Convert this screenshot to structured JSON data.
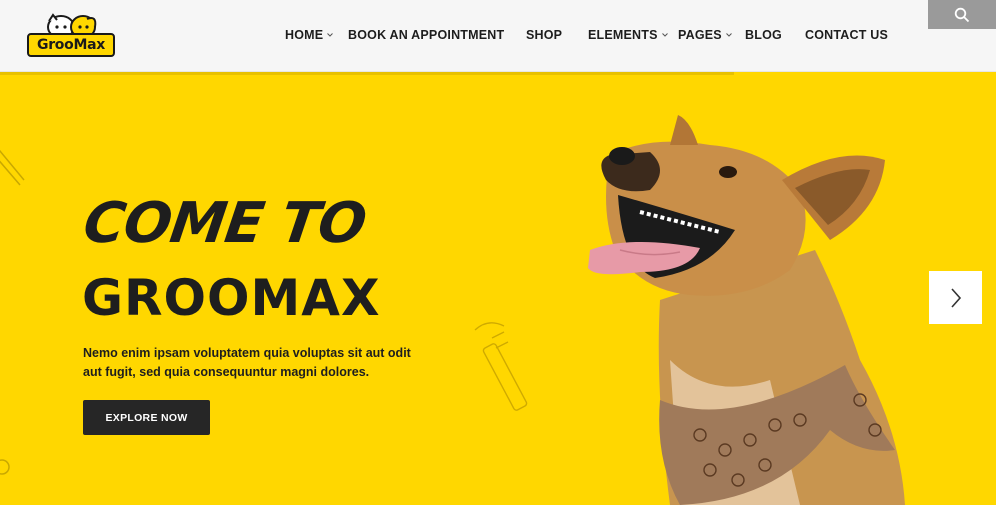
{
  "logo": {
    "text": "GrooMax"
  },
  "nav": {
    "items": [
      {
        "label": "HOME",
        "has_dropdown": true
      },
      {
        "label": "BOOK AN APPOINTMENT",
        "has_dropdown": false
      },
      {
        "label": "SHOP",
        "has_dropdown": false
      },
      {
        "label": "ELEMENTS",
        "has_dropdown": true
      },
      {
        "label": "PAGES",
        "has_dropdown": true
      },
      {
        "label": "BLOG",
        "has_dropdown": false
      },
      {
        "label": "CONTACT US",
        "has_dropdown": false
      }
    ]
  },
  "search": {
    "icon": "search-icon"
  },
  "hero": {
    "title_line1": "COME TO",
    "title_line2": "GROOMAX",
    "text": "Nemo enim ipsam voluptatem quia voluptas sit aut odit aut fugit, sed quia consequuntur magni dolores.",
    "button": "EXPLORE NOW"
  },
  "slider": {
    "next_icon": "chevron-right-icon"
  },
  "colors": {
    "accent": "#ffd700",
    "dark": "#1e1e1e",
    "header_bg": "#f6f6f6"
  }
}
